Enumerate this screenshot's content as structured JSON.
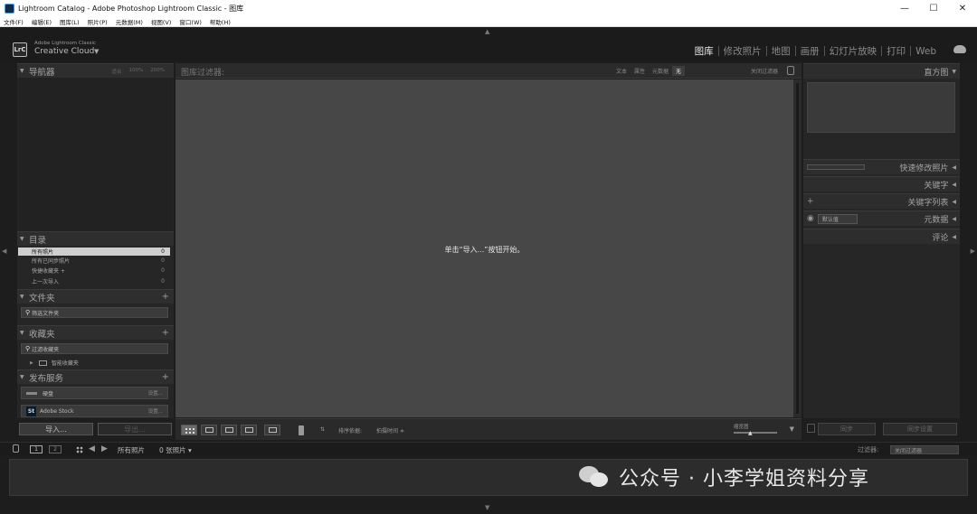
{
  "window": {
    "title": "Lightroom Catalog - Adobe Photoshop Lightroom Classic - 图库",
    "controls": [
      "—",
      "☐",
      "✕"
    ]
  },
  "menu": [
    "文件(F)",
    "编辑(E)",
    "图库(L)",
    "照片(P)",
    "元数据(M)",
    "视图(V)",
    "窗口(W)",
    "帮助(H)"
  ],
  "identity": {
    "badge": "LrC",
    "small": "Adobe Lightroom Classic",
    "big": "Creative Cloud",
    "dropdown": "▼"
  },
  "modules": [
    {
      "label": "图库",
      "active": true
    },
    {
      "label": "修改照片",
      "active": false
    },
    {
      "label": "地图",
      "active": false
    },
    {
      "label": "画册",
      "active": false
    },
    {
      "label": "幻灯片放映",
      "active": false
    },
    {
      "label": "打印",
      "active": false
    },
    {
      "label": "Web",
      "active": false
    }
  ],
  "left": {
    "navigator": {
      "title": "导航器",
      "sizes": [
        "适合",
        "100%",
        "200%"
      ]
    },
    "catalog": {
      "title": "目录",
      "items": [
        {
          "label": "所有照片",
          "count": "0"
        },
        {
          "label": "所有已同步照片",
          "count": "0"
        },
        {
          "label": "快捷收藏夹 +",
          "count": "0"
        },
        {
          "label": "上一次导入",
          "count": "0"
        }
      ]
    },
    "folders": {
      "title": "文件夹",
      "filter": "筛选文件夹"
    },
    "collections": {
      "title": "收藏夹",
      "filter": "过滤收藏夹",
      "smart": "智能收藏夹"
    },
    "publish": {
      "title": "发布服务",
      "services": [
        {
          "name": "硬盘",
          "action": "设置..."
        },
        {
          "name": "Adobe Stock",
          "action": "设置..."
        }
      ]
    },
    "import": "导入...",
    "export": "导出..."
  },
  "filterbar": {
    "title": "图库过滤器:",
    "options": [
      "文本",
      "属性",
      "元数据",
      "无"
    ],
    "status": "关闭过滤器"
  },
  "grid": {
    "hint": "单击“导入...”按钮开始。"
  },
  "toolbar": {
    "sort_label": "排序依据:",
    "sort_value": "拍摄时间 ≑",
    "thumb_label": "缩览图",
    "menu": "▼"
  },
  "right": {
    "histogram": "直方图",
    "quick_develop": "快速修改照片",
    "keywording": "关键字",
    "keyword_list": "关键字列表",
    "metadata": "元数据",
    "metadata_preset": "默认值",
    "comments": "评论",
    "sync": "同步",
    "sync_settings": "同步设置"
  },
  "filmstrip": {
    "monitor1": "1",
    "monitor2": "2",
    "source": "所有照片",
    "count": "0 张照片 ▾",
    "filter_label": "过滤器:",
    "filter_value": "关闭过滤器"
  },
  "watermark": "公众号 · 小李学姐资料分享",
  "colors": {
    "background": "#1d1d1d",
    "panel": "#262626",
    "grid": "#474747",
    "selected": "#cfcfcf"
  }
}
